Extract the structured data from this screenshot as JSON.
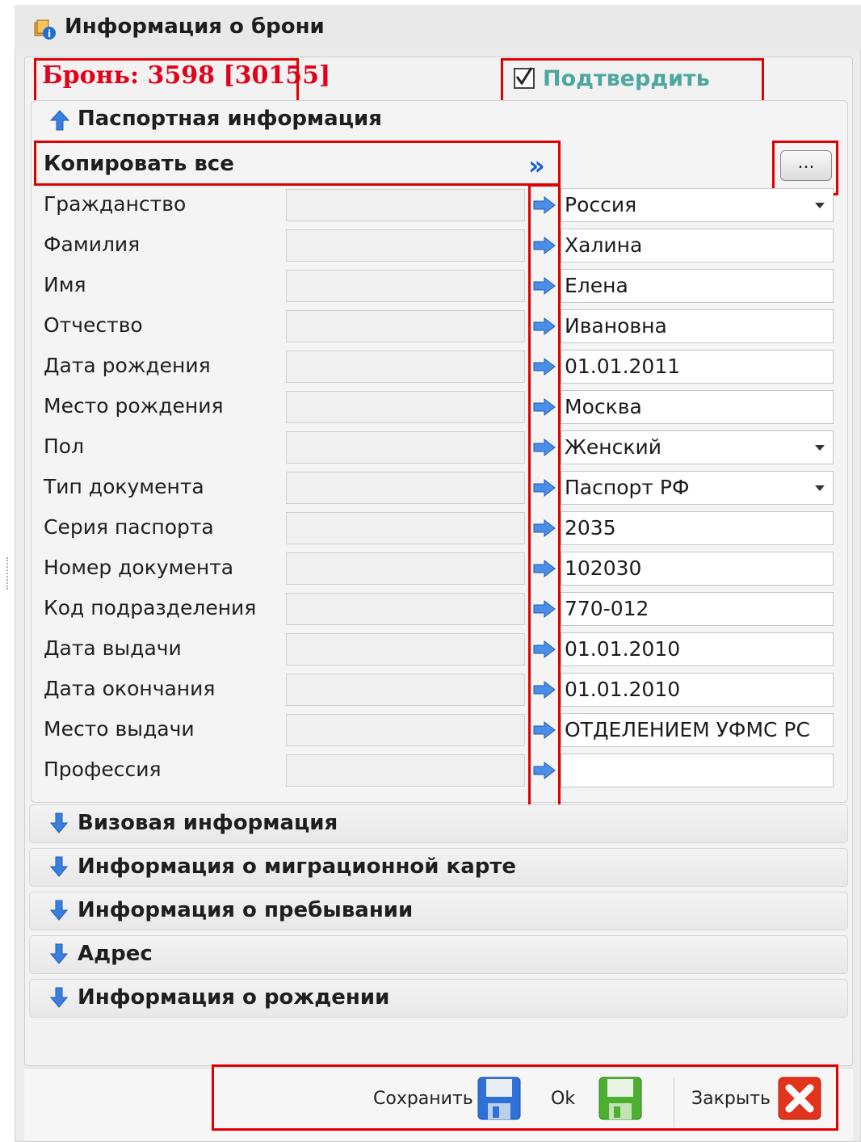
{
  "window": {
    "title": "Информация о брони"
  },
  "booking": {
    "label": "Бронь:  3598 [30155]"
  },
  "confirm": {
    "label": "Подтвердить",
    "checked": true
  },
  "passport_section": {
    "title": "Паспортная информация",
    "copy_all": "Копировать все",
    "browse_button": "...",
    "fields": [
      {
        "label": "Гражданство",
        "value": "Россия",
        "dropdown": true
      },
      {
        "label": "Фамилия",
        "value": "Халина",
        "dropdown": false
      },
      {
        "label": "Имя",
        "value": "Елена",
        "dropdown": false
      },
      {
        "label": "Отчество",
        "value": "Ивановна",
        "dropdown": false
      },
      {
        "label": "Дата рождения",
        "value": "01.01.2011",
        "dropdown": false
      },
      {
        "label": "Место рождения",
        "value": "Москва",
        "dropdown": false
      },
      {
        "label": "Пол",
        "value": "Женский",
        "dropdown": true
      },
      {
        "label": "Тип документа",
        "value": "Паспорт РФ",
        "dropdown": true
      },
      {
        "label": "Серия паспорта",
        "value": "2035",
        "dropdown": false
      },
      {
        "label": "Номер документа",
        "value": "102030",
        "dropdown": false
      },
      {
        "label": "Код подразделения",
        "value": "770-012",
        "dropdown": false
      },
      {
        "label": "Дата выдачи",
        "value": "01.01.2010",
        "dropdown": false
      },
      {
        "label": "Дата окончания",
        "value": "01.01.2010",
        "dropdown": false
      },
      {
        "label": "Место выдачи",
        "value": "ОТДЕЛЕНИЕМ УФМС РС",
        "dropdown": false
      },
      {
        "label": "Профессия",
        "value": "",
        "dropdown": false
      }
    ]
  },
  "sections": [
    "Визовая информация",
    "Информация о миграционной карте",
    "Информация о пребывании",
    "Адрес",
    "Информация о рождении"
  ],
  "footer": {
    "save": "Сохранить",
    "ok": "Ok",
    "close": "Закрыть"
  },
  "colors": {
    "accent_red": "#e3001b",
    "confirm_teal": "#4fa6a0",
    "arrow_blue": "#1a5fd6",
    "highlight_red": "#e10000"
  }
}
